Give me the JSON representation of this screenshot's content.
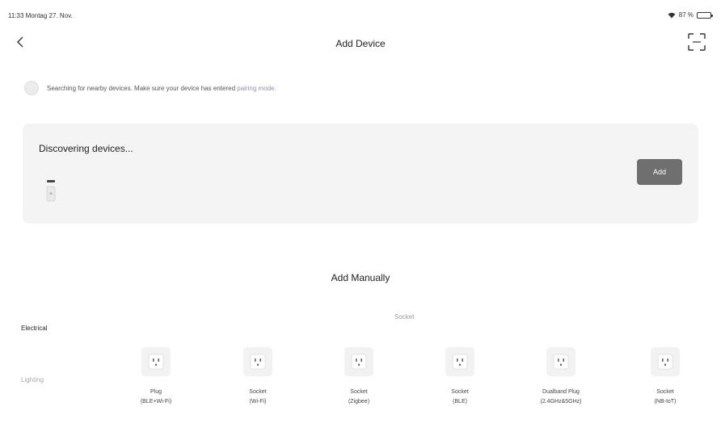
{
  "status_bar": {
    "time": "11:33 Montag 27. Nov.",
    "battery": "87 %"
  },
  "nav": {
    "title": "Add Device"
  },
  "search_hint": {
    "text": "Searching for nearby devices. Make sure your device has entered ",
    "link": "pairing mode."
  },
  "discover": {
    "title": "Discovering devices...",
    "add_label": "Add"
  },
  "manual": {
    "title": "Add Manually",
    "section_label": "Socket",
    "categories": [
      {
        "label": "Electrical"
      },
      {
        "label": "Lighting"
      }
    ],
    "devices": [
      {
        "line1": "Plug",
        "line2": "(BLE+Wi-Fi)"
      },
      {
        "line1": "Socket",
        "line2": "(Wi-Fi)"
      },
      {
        "line1": "Socket",
        "line2": "(Zigbee)"
      },
      {
        "line1": "Socket",
        "line2": "(BLE)"
      },
      {
        "line1": "Dualband Plug",
        "line2": "(2.4GHz&5GHz)"
      },
      {
        "line1": "Socket",
        "line2": "(NB-IoT)"
      }
    ]
  },
  "icons": {
    "back": "chevron-left-icon",
    "scan": "scan-icon",
    "wifi": "wifi-icon",
    "battery": "battery-icon",
    "spinner": "spinner-icon",
    "device": "device-icon",
    "socket": "socket-icon"
  },
  "colors": {
    "card_bg": "#f4f4f4",
    "add_button": "#6f6f6f",
    "link": "#8a93b8"
  }
}
